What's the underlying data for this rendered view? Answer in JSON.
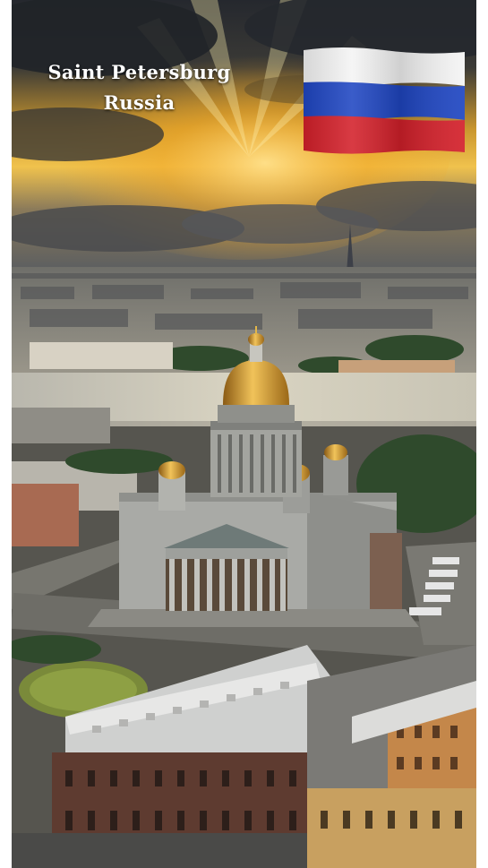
{
  "caption": {
    "city": "Saint Petersburg",
    "country": "Russia"
  },
  "flag": {
    "icon": "russian-flag-icon",
    "stripes": [
      "#f4f4f4",
      "#1f46c2",
      "#d3202a"
    ]
  },
  "colors": {
    "sky_dark": "#2a2d33",
    "sun_glow": "#f2b632",
    "river": "#c9c7bd",
    "dome_gold": "#d9a22c",
    "stone": "#a9aaa6"
  }
}
